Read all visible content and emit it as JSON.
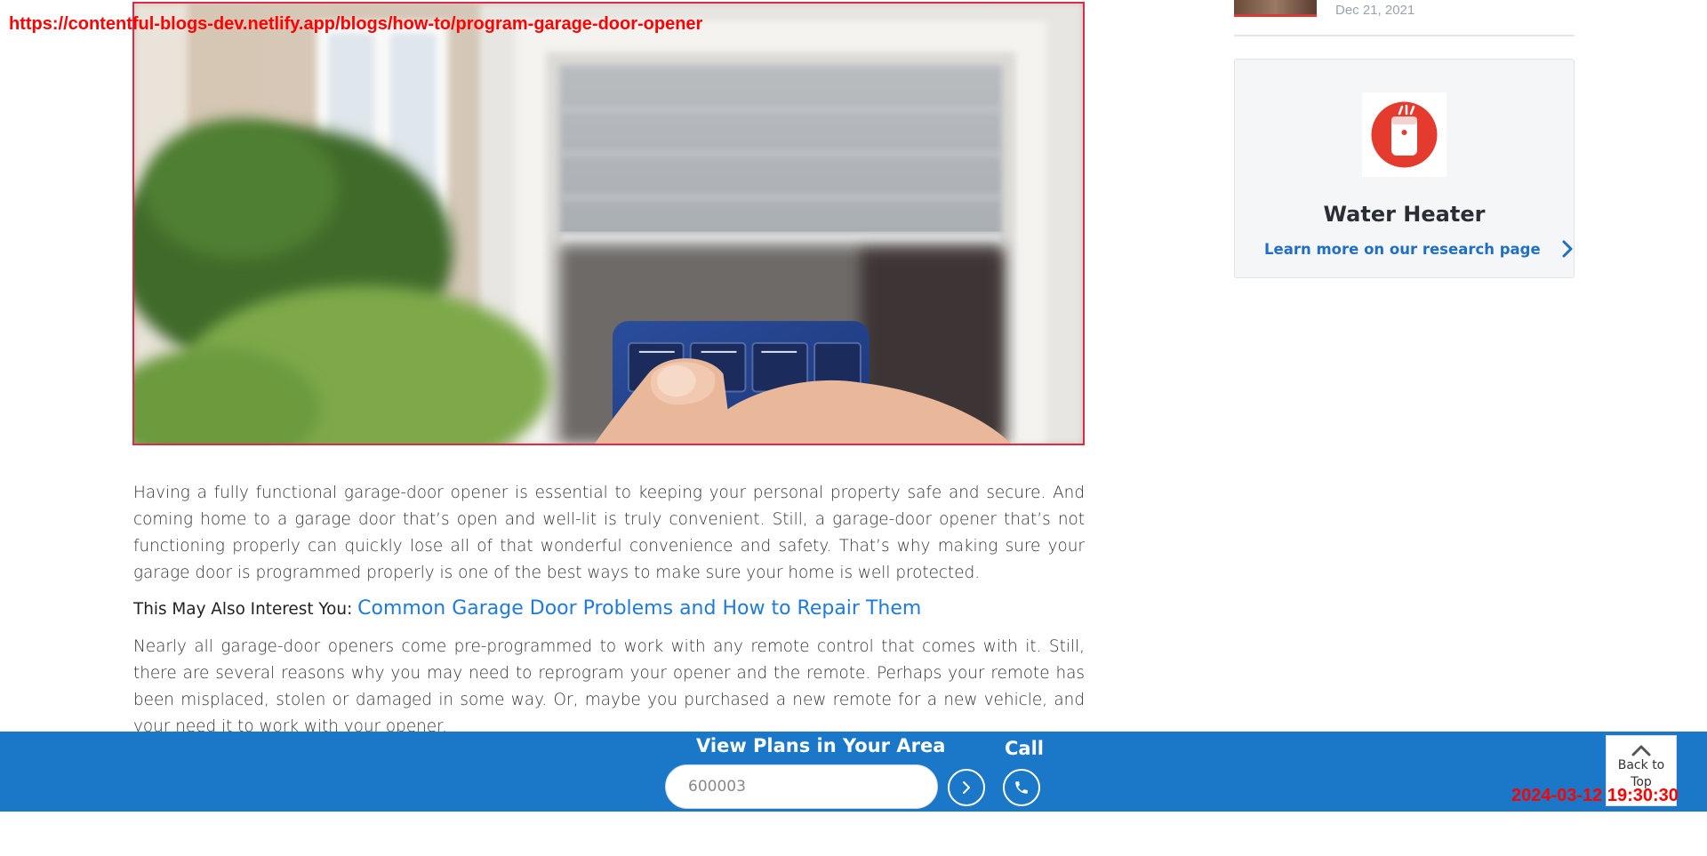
{
  "overlay": {
    "url": "https://contentful-blogs-dev.netlify.app/blogs/how-to/program-garage-door-opener",
    "timestamp": "2024-03-12 19:30:30"
  },
  "hero": {
    "icon": "garage-door-remote-photo"
  },
  "article": {
    "paragraph1": "Having a fully functional garage-door opener is essential to keeping your personal property safe and secure. And coming home to a garage door that’s open and well-lit is truly convenient. Still, a garage-door opener that’s not functioning properly can quickly lose all of that wonderful convenience and safety. That’s why making sure your garage door is programmed properly is one of the best ways to make sure your home is well protected.",
    "interest_prefix": "This May Also Interest You:",
    "interest_link": "Common Garage Door Problems and How to Repair Them",
    "paragraph2": "Nearly all garage-door openers come pre-programmed to work with any remote control that comes with it. Still, there are several reasons why you may need to reprogram your opener and the remote. Perhaps your remote has been misplaced, stolen or damaged in some way. Or, maybe you purchased a new remote for a new vehicle, and your need it to work with your opener."
  },
  "sidebar": {
    "previous_post_date": "Dec 21, 2021",
    "card": {
      "icon": "water-heater-icon",
      "title": "Water Heater",
      "link_label": "Learn more on our research page"
    }
  },
  "bottom_bar": {
    "plans_label": "View Plans in Your Area",
    "zip_value": "600003",
    "call_label": "Call",
    "back_to_top_label": "Back to Top"
  },
  "colors": {
    "bar_blue": "#1b77c8",
    "link_blue": "#1f7ae0",
    "accent_red": "#e0284a",
    "icon_red": "#e53b2f"
  }
}
